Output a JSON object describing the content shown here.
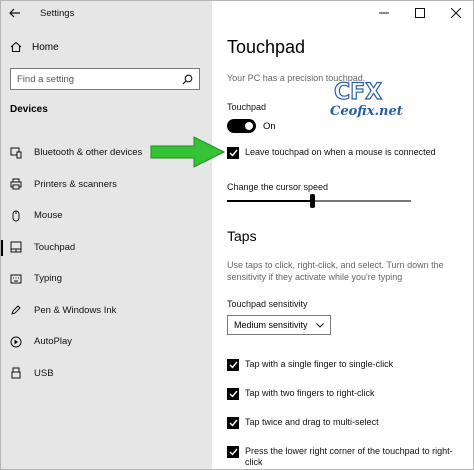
{
  "window": {
    "title": "Settings"
  },
  "sidebar": {
    "home_label": "Home",
    "search_placeholder": "Find a setting",
    "section_title": "Devices",
    "items": [
      {
        "label": "Bluetooth & other devices",
        "icon": "bluetooth-device-icon"
      },
      {
        "label": "Printers & scanners",
        "icon": "printer-icon"
      },
      {
        "label": "Mouse",
        "icon": "mouse-icon"
      },
      {
        "label": "Touchpad",
        "icon": "touchpad-icon",
        "active": true
      },
      {
        "label": "Typing",
        "icon": "keyboard-icon"
      },
      {
        "label": "Pen & Windows Ink",
        "icon": "pen-icon"
      },
      {
        "label": "AutoPlay",
        "icon": "autoplay-icon"
      },
      {
        "label": "USB",
        "icon": "usb-icon"
      }
    ]
  },
  "main": {
    "title": "Touchpad",
    "subtitle": "Your PC has a precision touchpad.",
    "touchpad_label": "Touchpad",
    "toggle_state": "On",
    "leave_on_label": "Leave touchpad on when a mouse is connected",
    "cursor_speed_label": "Change the cursor speed",
    "cursor_speed_fraction": 0.45,
    "taps_heading": "Taps",
    "taps_description": "Use taps to click, right-click, and select. Turn down the sensitivity if they activate while you're typing",
    "sensitivity_label": "Touchpad sensitivity",
    "sensitivity_value": "Medium sensitivity",
    "tap_options": [
      "Tap with a single finger to single-click",
      "Tap with two fingers to right-click",
      "Tap twice and drag to multi-select",
      "Press the lower right corner of the touchpad to right-click"
    ]
  },
  "watermark": {
    "text": "Ceofix.net"
  },
  "colors": {
    "accent": "#000000",
    "sidebar_bg": "#e6e6e6",
    "arrow_green": "#35c335",
    "watermark_blue": "#2a5fa8"
  }
}
